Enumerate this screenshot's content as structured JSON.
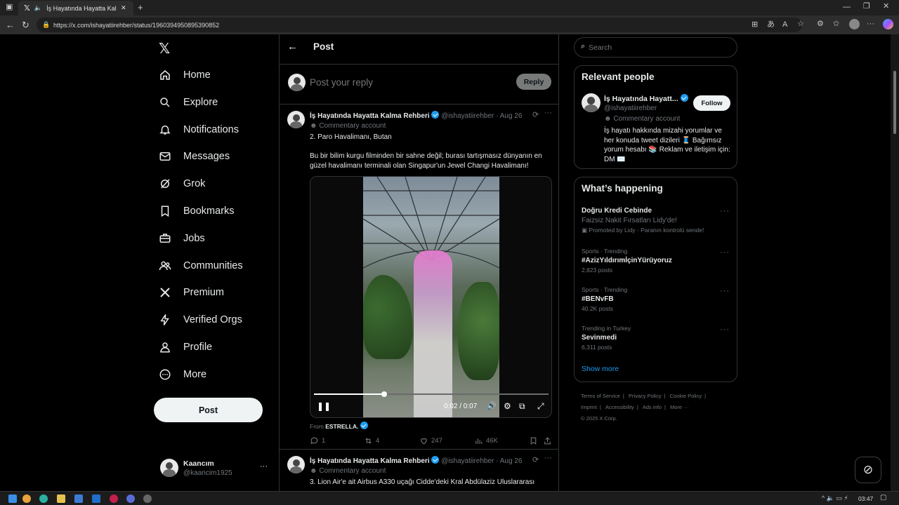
{
  "browser": {
    "tab_title": "İş Hayatında Hayatta Kalma R",
    "url": "https://x.com/ishayatiirehber/status/1960394950895390852"
  },
  "nav": {
    "items": [
      {
        "label": "Home",
        "icon": "home-icon"
      },
      {
        "label": "Explore",
        "icon": "search-icon"
      },
      {
        "label": "Notifications",
        "icon": "bell-icon"
      },
      {
        "label": "Messages",
        "icon": "mail-icon"
      },
      {
        "label": "Grok",
        "icon": "grok-icon"
      },
      {
        "label": "Bookmarks",
        "icon": "bookmark-icon"
      },
      {
        "label": "Jobs",
        "icon": "briefcase-icon"
      },
      {
        "label": "Communities",
        "icon": "people-icon"
      },
      {
        "label": "Premium",
        "icon": "x-logo-icon"
      },
      {
        "label": "Verified Orgs",
        "icon": "lightning-icon"
      },
      {
        "label": "Profile",
        "icon": "person-icon"
      },
      {
        "label": "More",
        "icon": "more-circle-icon"
      }
    ],
    "post_label": "Post",
    "account": {
      "name": "Kaancım",
      "handle": "@kaancim1925"
    }
  },
  "header": {
    "title": "Post"
  },
  "reply": {
    "placeholder": "Post your reply",
    "button": "Reply"
  },
  "tweet1": {
    "author": "İş Hayatında Hayatta Kalma Rehberi",
    "handle": "@ishayatiirehber",
    "date": "· Aug 26",
    "label": "Commentary account",
    "line1": "2. Paro Havalimanı, Butan",
    "body": "Bu bir bilim kurgu filminden bir sahne değil; burası tartışmasız dünyanın en güzel havalimanı terminali olan Singapur'un Jewel Changi Havalimanı!",
    "video_time": "0:02 / 0:07",
    "video_progress": 0.3,
    "from_label": "From",
    "from_name": "ESTRELLA.",
    "replies": "1",
    "reposts": "4",
    "likes": "247",
    "views": "46K"
  },
  "tweet2": {
    "author": "İş Hayatında Hayatta Kalma Rehberi",
    "handle": "@ishayatiirehber",
    "date": "· Aug 26",
    "label": "Commentary account",
    "line1": "3. Lion Air'e ait Airbus A330 uçağı Cidde'deki Kral Abdülaziz Uluslararası"
  },
  "search": {
    "placeholder": "Search"
  },
  "relevant": {
    "title": "Relevant people",
    "name": "İş Hayatında Hayatt...",
    "handle": "@ishayatiirehber",
    "label": "Commentary account",
    "bio": "İş hayatı hakkında mizahi yorumlar ve her konuda tweet dizileri 🧵 Bağımsız yorum hesabı 📚 Reklam ve iletişim için: DM ✉️",
    "follow": "Follow"
  },
  "happening": {
    "title": "What’s happening",
    "promo": {
      "title": "Doğru Kredi Cebinde",
      "sub": "Faizsiz Nakit Fırsatları Lidy'de!",
      "promoted": "Promoted by Lidy - Paranın kontrolü sende!"
    },
    "trends": [
      {
        "context": "Sports · Trending",
        "name": "#AzizYıldırımİçinYürüyoruz",
        "count": "2,823 posts"
      },
      {
        "context": "Sports · Trending",
        "name": "#BENvFB",
        "count": "40.2K posts"
      },
      {
        "context": "Trending in Turkey",
        "name": "Sevinmedi",
        "count": "6,311 posts"
      }
    ],
    "show_more": "Show more"
  },
  "footer": {
    "links": [
      "Terms of Service",
      "Privacy Policy",
      "Cookie Policy",
      "Imprint",
      "Accessibility",
      "Ads info",
      "More ···"
    ],
    "copyright": "© 2025 X Corp."
  },
  "taskbar": {
    "time": "03:47"
  },
  "colors": {
    "accent": "#1d9bf0",
    "background": "#000000",
    "border": "#2f3336",
    "muted": "#71767b"
  }
}
